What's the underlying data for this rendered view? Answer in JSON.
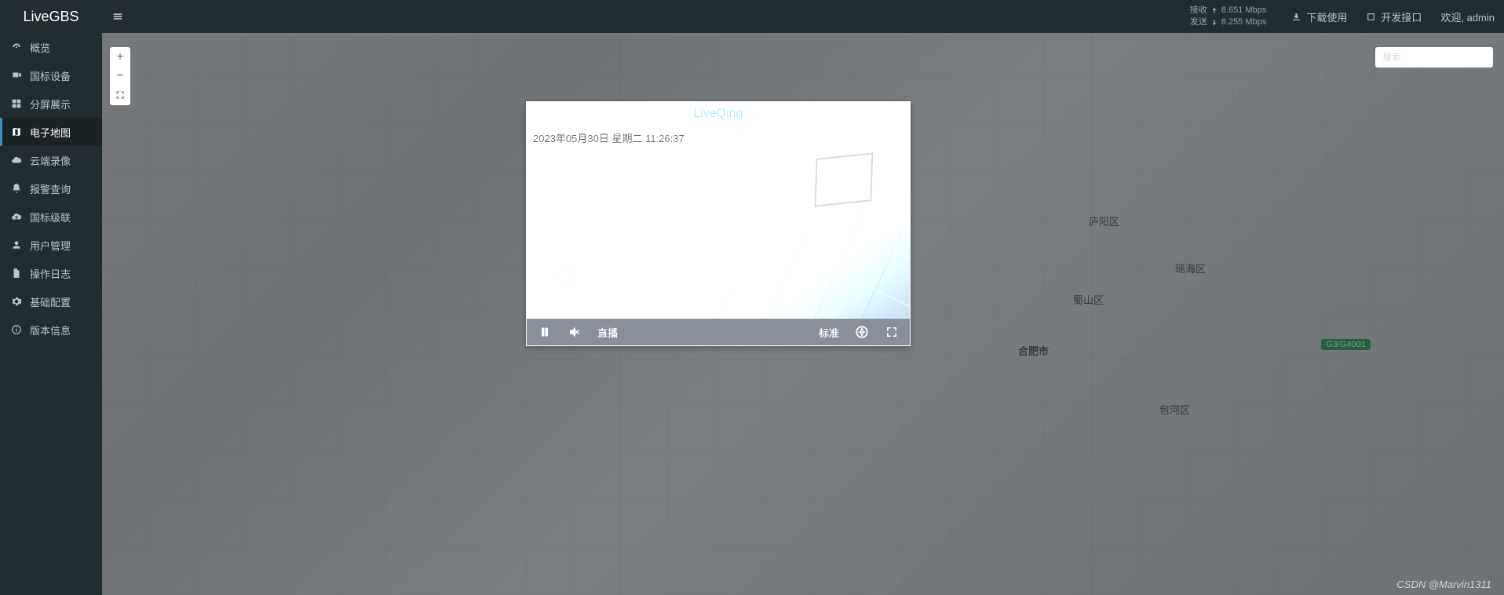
{
  "header": {
    "brand": "LiveGBS",
    "stats": {
      "recv_label": "接收",
      "recv_value": "8.651 Mbps",
      "send_label": "发送",
      "send_value": "8.255 Mbps"
    },
    "download_label": "下载使用",
    "api_label": "开发接口",
    "welcome_label": "欢迎, admin"
  },
  "sidebar": {
    "items": [
      {
        "label": "概览",
        "icon": "dashboard"
      },
      {
        "label": "国标设备",
        "icon": "camera"
      },
      {
        "label": "分屏展示",
        "icon": "grid"
      },
      {
        "label": "电子地图",
        "icon": "map",
        "active": true
      },
      {
        "label": "云端录像",
        "icon": "cloud"
      },
      {
        "label": "报警查询",
        "icon": "bell"
      },
      {
        "label": "国标级联",
        "icon": "cloud-up"
      },
      {
        "label": "用户管理",
        "icon": "user"
      },
      {
        "label": "操作日志",
        "icon": "file"
      },
      {
        "label": "基础配置",
        "icon": "cog"
      },
      {
        "label": "版本信息",
        "icon": "info"
      }
    ]
  },
  "search": {
    "placeholder": "搜索"
  },
  "video": {
    "title": "LiveQing",
    "timestamp": "2023年05月30日  星期二  11:26:37",
    "live_label": "直播",
    "quality_label": "标准"
  },
  "map_labels": {
    "luyang": "庐阳区",
    "yaohai": "瑶海区",
    "shushan": "蜀山区",
    "hefei": "合肥市",
    "baohe": "包河区",
    "road": "G3/G4001"
  },
  "watermark": "CSDN @Marvin1311"
}
